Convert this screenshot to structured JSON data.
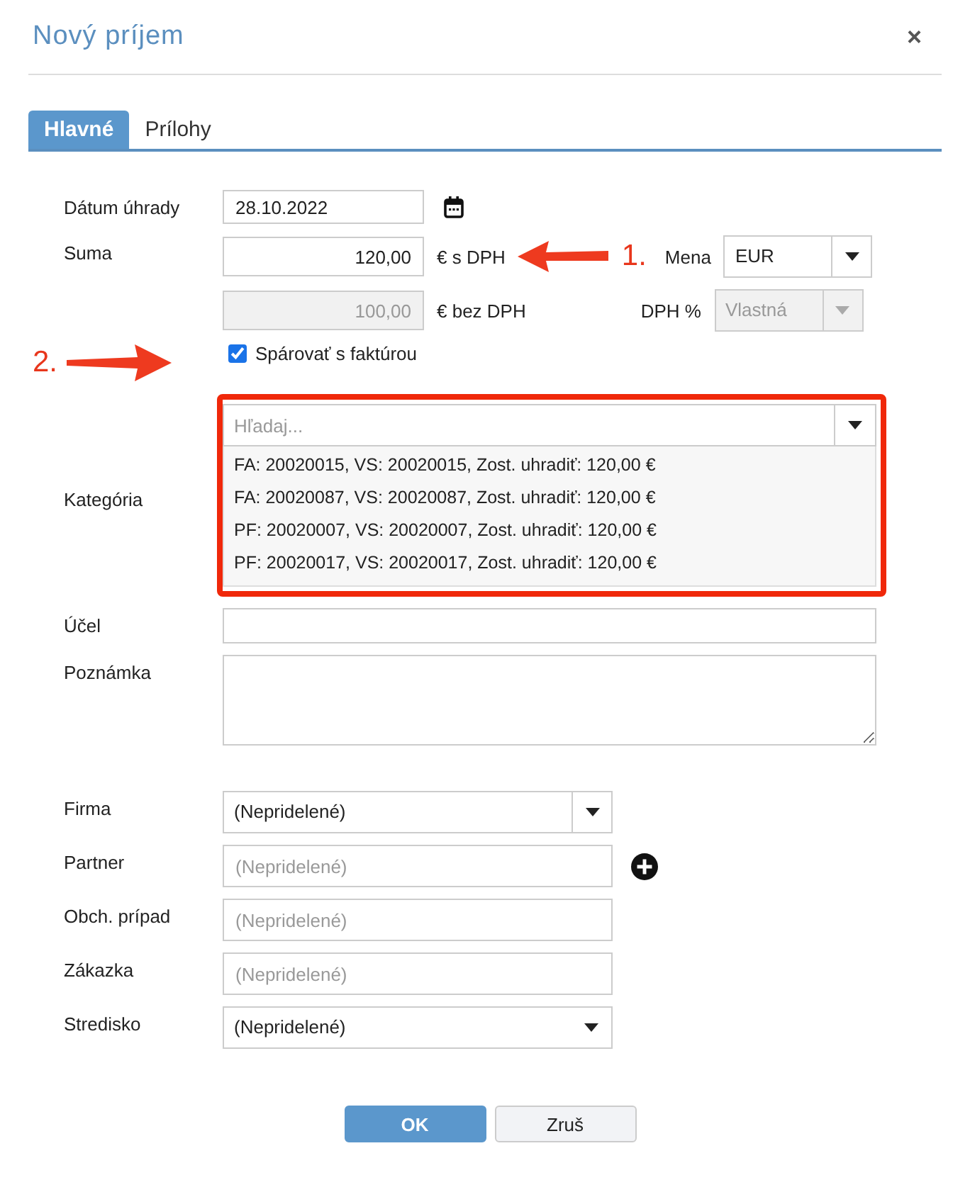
{
  "dialog": {
    "title": "Nový príjem",
    "close": "×"
  },
  "tabs": [
    {
      "label": "Hlavné",
      "selected": true
    },
    {
      "label": "Prílohy",
      "selected": false
    }
  ],
  "date": {
    "label": "Dátum úhrady",
    "value": "28.10.2022"
  },
  "amount": {
    "label": "Suma",
    "value": "120,00",
    "unit": "€ s DPH",
    "annotation": "1."
  },
  "currency": {
    "label": "Mena",
    "value": "EUR"
  },
  "net": {
    "value": "100,00",
    "unit": "€ bez DPH",
    "disabled": true
  },
  "vat": {
    "label": "DPH %",
    "value": "Vlastná",
    "disabled": true
  },
  "pairing": {
    "label": "Spárovať s faktúrou",
    "checked": true,
    "annotation": "2."
  },
  "category": {
    "label": "Kategória",
    "placeholder": "Hľadaj...",
    "options": [
      "FA: 20020015, VS: 20020015, Zost. uhradiť: 120,00 €",
      "FA: 20020087, VS: 20020087, Zost. uhradiť: 120,00 €",
      "PF: 20020007, VS: 20020007, Zost. uhradiť: 120,00 €",
      "PF: 20020017, VS: 20020017, Zost. uhradiť: 120,00 €"
    ]
  },
  "purpose": {
    "label": "Účel"
  },
  "note": {
    "label": "Poznámka"
  },
  "assignments": [
    {
      "label": "Firma",
      "kind": "select",
      "value": "(Nepridelené)"
    },
    {
      "label": "Partner",
      "kind": "lookup_add",
      "placeholder": "(Nepridelené)"
    },
    {
      "label": "Obch. prípad",
      "kind": "lookup",
      "placeholder": "(Nepridelené)"
    },
    {
      "label": "Zákazka",
      "kind": "lookup",
      "placeholder": "(Nepridelené)"
    },
    {
      "label": "Stredisko",
      "kind": "plain_select",
      "value": "(Nepridelené)"
    }
  ],
  "buttons": [
    {
      "label": "OK",
      "primary": true
    },
    {
      "label": "Zruš",
      "primary": false
    }
  ]
}
